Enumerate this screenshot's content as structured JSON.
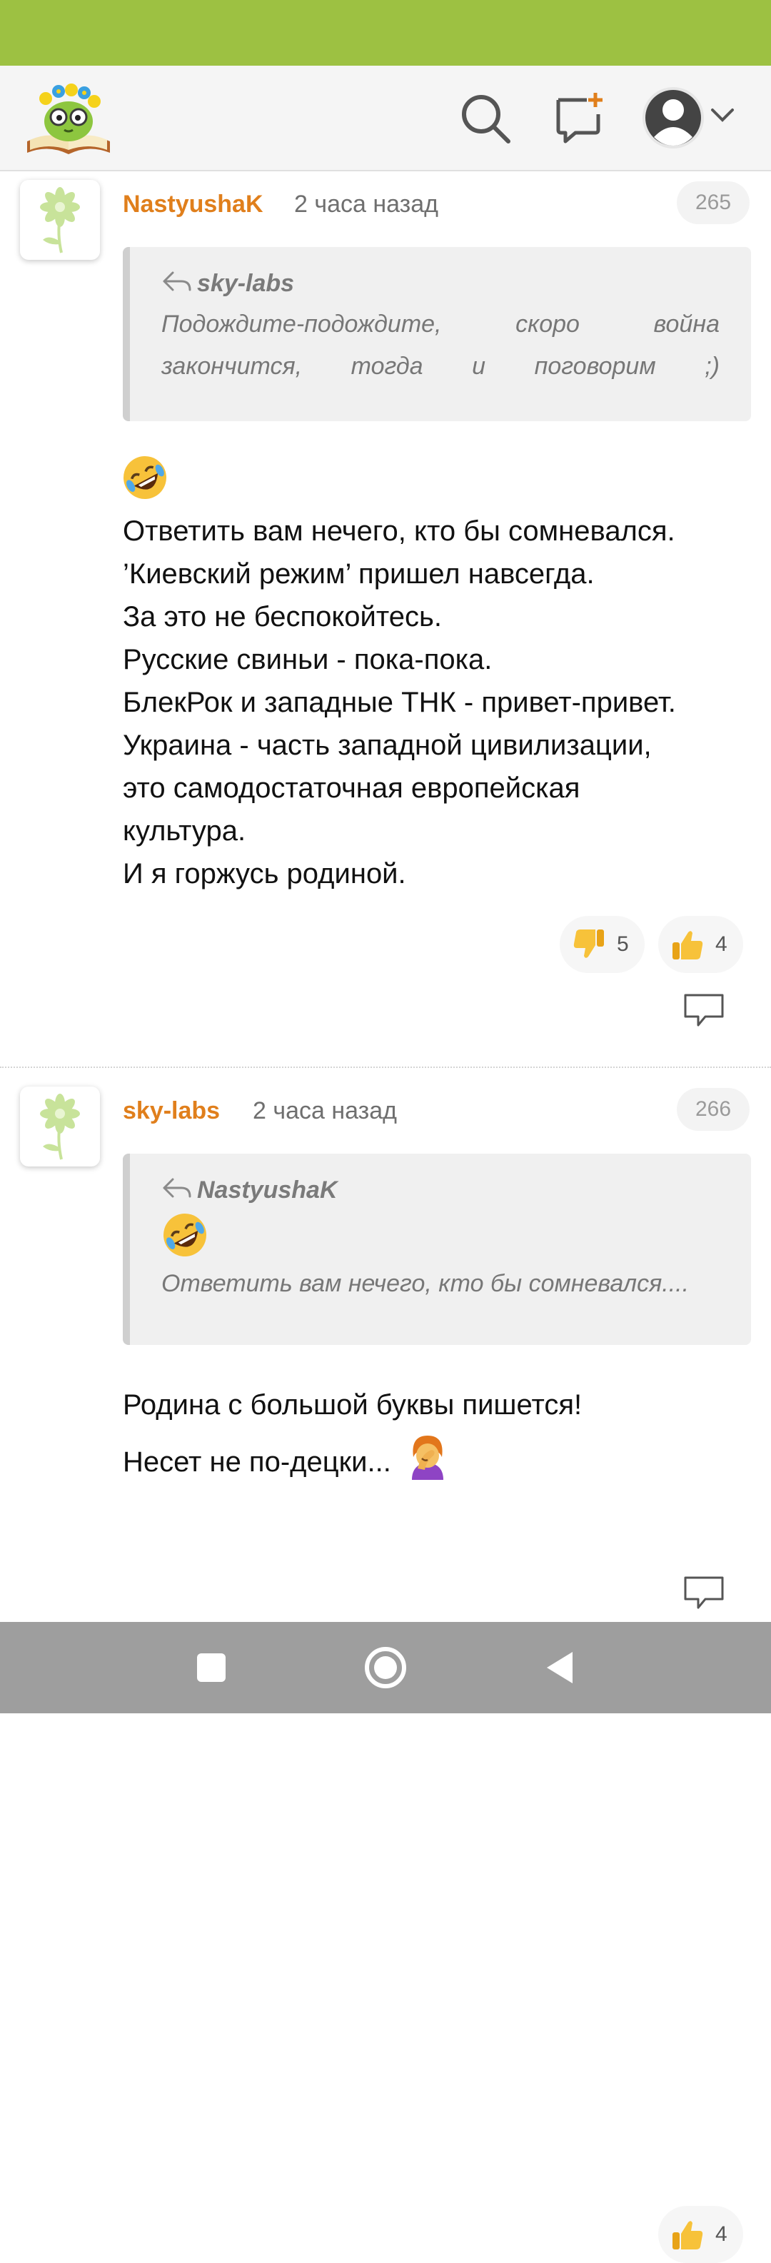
{
  "colors": {
    "status_bar": "#9dc142",
    "accent": "#e07f1c",
    "nav_bar": "#9e9e9e"
  },
  "header": {
    "logo": "book-flower-mascot-logo",
    "icons": [
      "search-icon",
      "new-post-icon",
      "user-avatar-icon",
      "chevron-down-icon"
    ]
  },
  "comments": [
    {
      "author": "NastyushaK",
      "time": "2 часа назад",
      "number": "265",
      "avatar": "daisy-avatar",
      "quote": {
        "author": "sky-labs",
        "text": "Подождите-подождите, скоро война закончится, тогда и поговорим ;)"
      },
      "emoji": "rolling-on-floor-laughing",
      "lines": [
        "Ответить вам нечего, кто бы сомневался.",
        "’Киевский режим’ пришел навсегда.",
        "За это не беспокойтесь.",
        "Русские свиньи - пока-пока.",
        "БлекРок и западные ТНК - привет-привет.",
        "Украина - часть западной цивилизации,",
        "это самодостаточная европейская",
        "культура.",
        "И я горжусь родиной."
      ],
      "dislikes": "5",
      "likes": "4"
    },
    {
      "author": "sky-labs",
      "time": "2 часа назад",
      "number": "266",
      "avatar": "daisy-avatar",
      "quote": {
        "author": "NastyushaK",
        "emoji": "rolling-on-floor-laughing",
        "text": "Ответить вам нечего, кто бы сомневался...."
      },
      "lines": [
        "Родина с большой буквы пишется!",
        "Несет не по-децки..."
      ],
      "trailing_emoji": "woman-facepalming",
      "likes": "4"
    }
  ],
  "nav": [
    "recent-apps-button",
    "home-button",
    "back-button"
  ]
}
